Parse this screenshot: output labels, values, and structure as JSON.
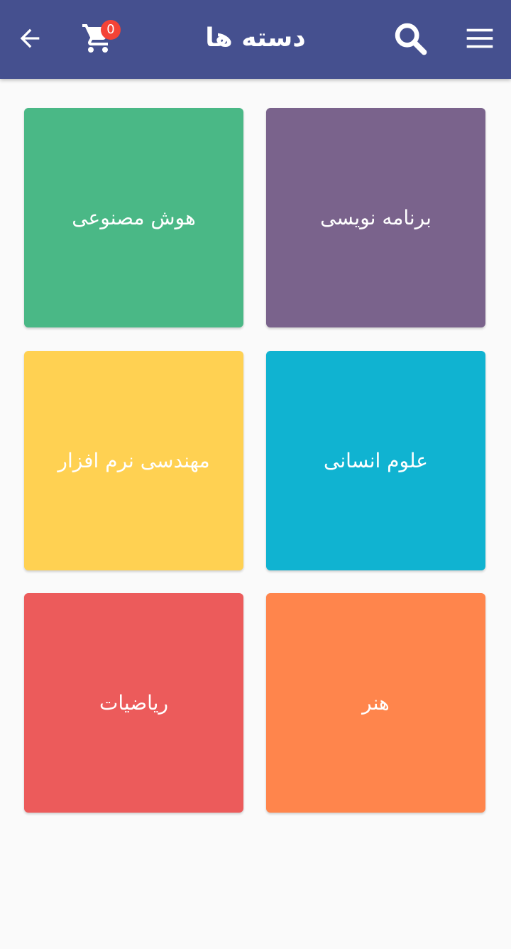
{
  "appbar": {
    "title": "دسته ها",
    "background": "#45508f",
    "cart_count": "0",
    "badge_color": "#f44336",
    "icons": {
      "back": "arrow-left-icon",
      "cart": "shopping-cart-icon",
      "search": "search-icon",
      "menu": "hamburger-menu-icon"
    }
  },
  "categories": [
    {
      "label": "برنامه نویسی",
      "color": "#7a638c"
    },
    {
      "label": "هوش مصنوعی",
      "color": "#4ab886"
    },
    {
      "label": "علوم انسانی",
      "color": "#10b3d1"
    },
    {
      "label": "مهندسی نرم افزار",
      "color": "#ffd152"
    },
    {
      "label": "هنر",
      "color": "#ff854c"
    },
    {
      "label": "ریاضیات",
      "color": "#ec5b5b"
    }
  ]
}
